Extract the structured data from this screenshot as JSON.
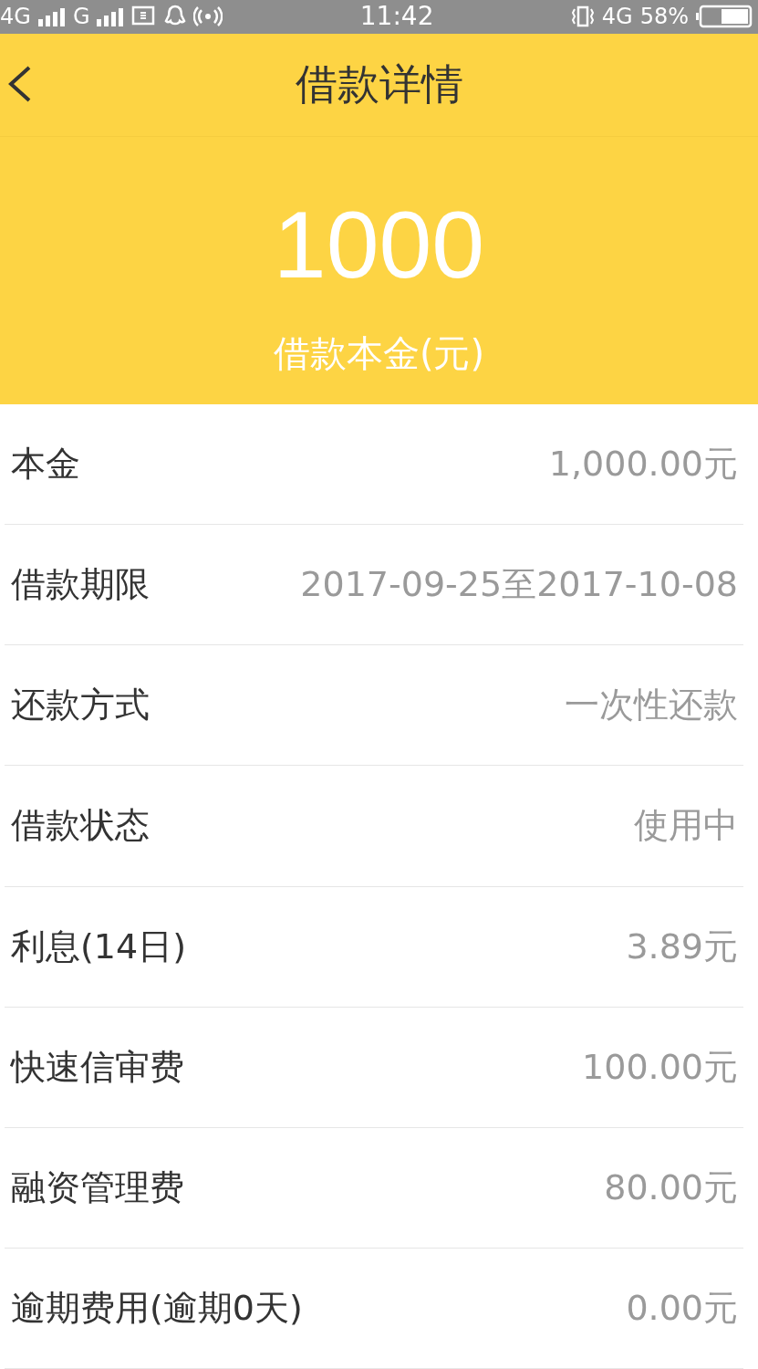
{
  "status_bar": {
    "network_1": "4G",
    "network_2": "G",
    "time": "11:42",
    "network_3": "4G",
    "battery": "58%"
  },
  "header": {
    "title": "借款详情"
  },
  "summary": {
    "amount": "1000",
    "caption": "借款本金(元)"
  },
  "rows": [
    {
      "label": "本金",
      "value": "1,000.00元"
    },
    {
      "label": "借款期限",
      "value": "2017-09-25至2017-10-08"
    },
    {
      "label": "还款方式",
      "value": "一次性还款"
    },
    {
      "label": "借款状态",
      "value": "使用中"
    },
    {
      "label": "利息(14日)",
      "value": "3.89元"
    },
    {
      "label": "快速信审费",
      "value": "100.00元"
    },
    {
      "label": "融资管理费",
      "value": "80.00元"
    },
    {
      "label": "逾期费用(逾期0天)",
      "value": "0.00元"
    }
  ]
}
